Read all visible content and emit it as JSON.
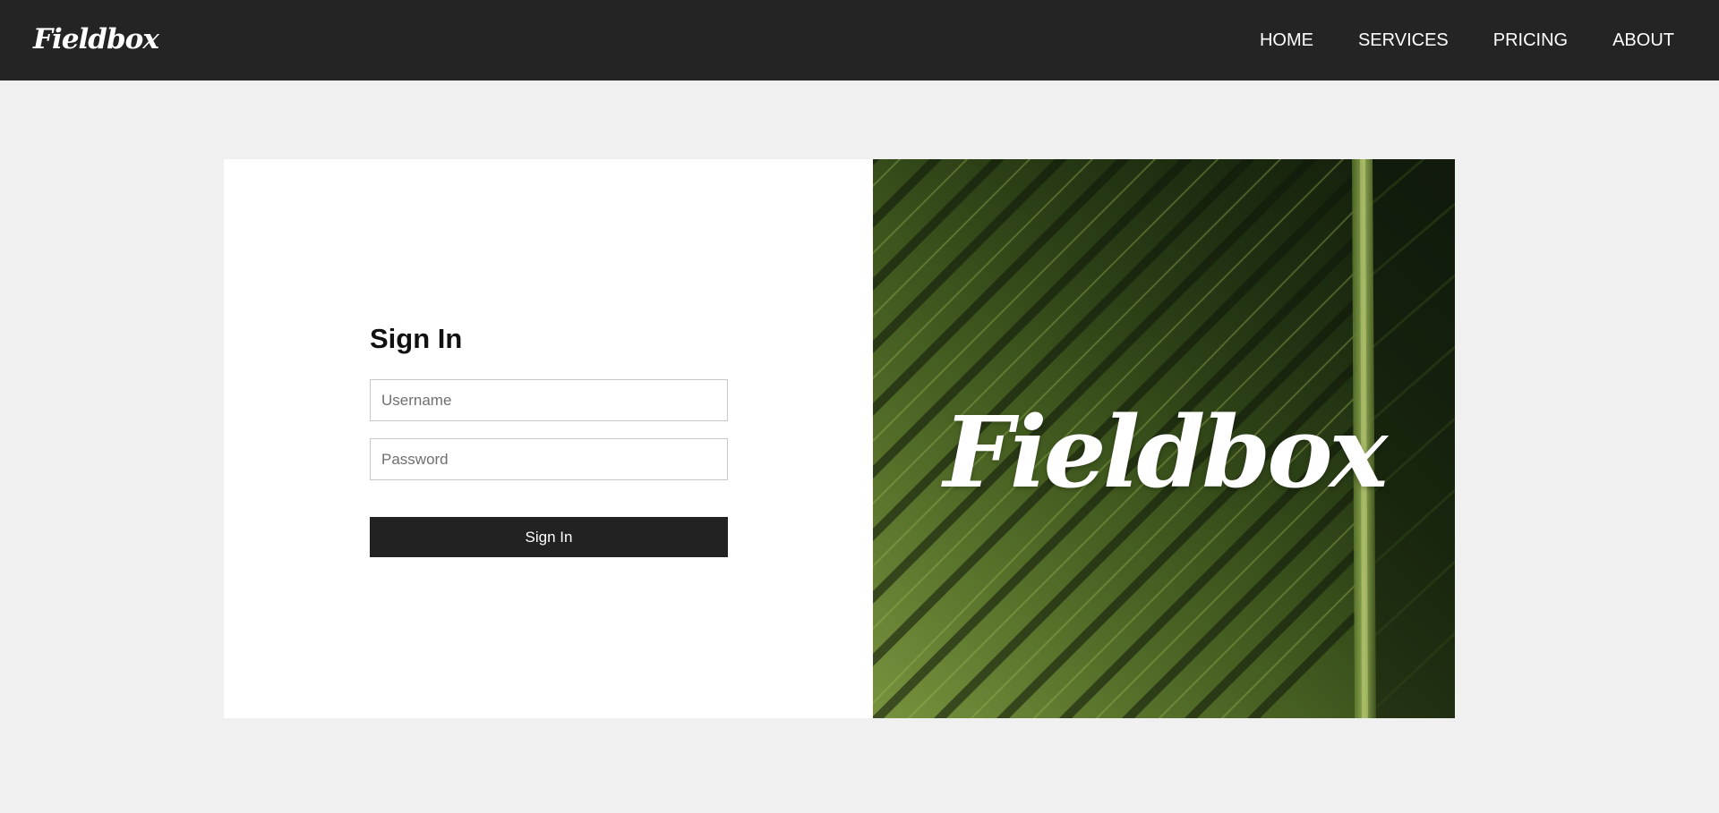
{
  "header": {
    "brand": "Fieldbox",
    "nav": [
      "HOME",
      "SERVICES",
      "PRICING",
      "ABOUT"
    ]
  },
  "login": {
    "title": "Sign In",
    "username_placeholder": "Username",
    "username_value": "",
    "password_placeholder": "Password",
    "password_value": "",
    "submit_label": "Sign In"
  },
  "hero": {
    "brand": "Fieldbox",
    "image": "green-leaf-photo"
  },
  "colors": {
    "navbar": "#242424",
    "page_bg": "#f0f0f0",
    "button": "#222222",
    "leaf_dark": "#1b2a12",
    "leaf_light": "#7c9a3a"
  }
}
